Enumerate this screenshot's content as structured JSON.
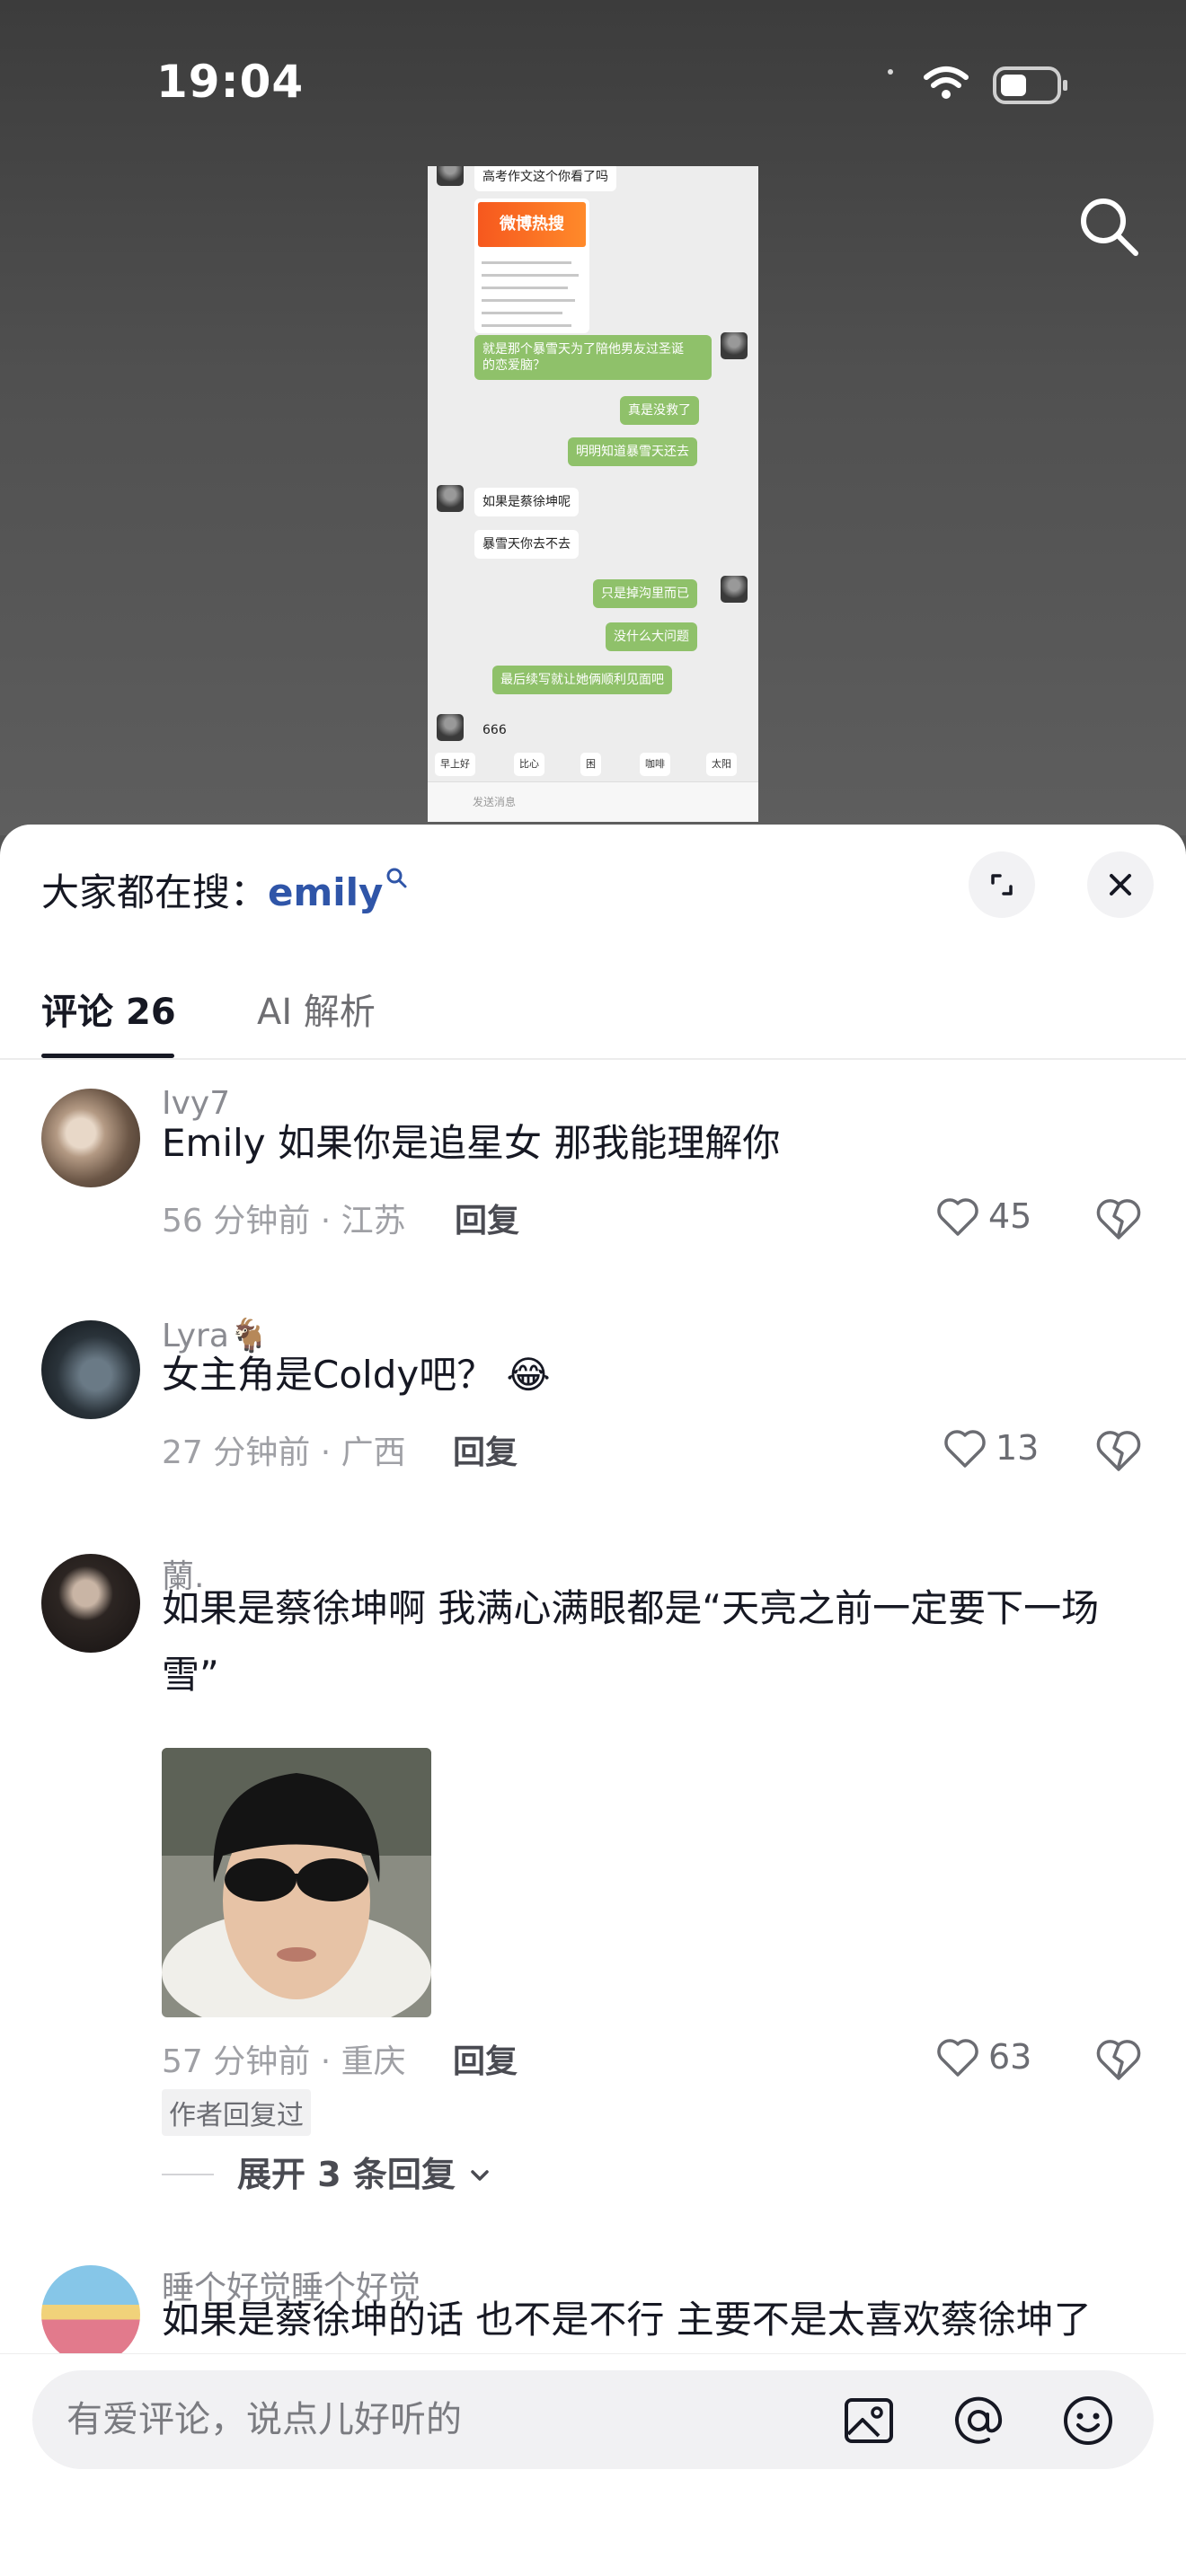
{
  "status_bar": {
    "time": "19:04"
  },
  "chat_preview": {
    "messages": [
      {
        "side": "in",
        "text": "高考作文这个你看了吗"
      },
      {
        "side": "out",
        "text": "就是那个暴雪天为了陪他男友过圣诞"
      },
      {
        "side": "out",
        "text": "的恋爱脑？"
      },
      {
        "side": "out",
        "text": "真是没救了"
      },
      {
        "side": "out",
        "text": "明明知道暴雪天还去"
      },
      {
        "side": "in",
        "text": "如果是蔡徐坤呢"
      },
      {
        "side": "in",
        "text": "暴雪天你去不去"
      },
      {
        "side": "out",
        "text": "只是掉沟里而已"
      },
      {
        "side": "out",
        "text": "没什么大问题"
      },
      {
        "side": "out",
        "text": "最后续写就让她俩顺利见面吧"
      },
      {
        "side": "in",
        "text": "666"
      }
    ],
    "card_title": "微博热搜",
    "quick_replies": [
      "早上好",
      "比心",
      "困",
      "咖啡",
      "太阳"
    ],
    "input_placeholder": "发送消息"
  },
  "sheet": {
    "suggest_label": "大家都在搜：",
    "suggest_keyword": "emily",
    "tabs": [
      {
        "label": "评论",
        "count": "26"
      },
      {
        "label": "AI 解析"
      }
    ]
  },
  "comments": [
    {
      "user": "Ivy7",
      "text": "Emily 如果你是追星女 那我能理解你",
      "time_loc": "56 分钟前 · 江苏",
      "reply_label": "回复",
      "likes": "45"
    },
    {
      "user": "Lyra🐐",
      "text": "女主角是Coldy吧？ 😂",
      "time_loc": "27 分钟前 · 广西",
      "reply_label": "回复",
      "likes": "13"
    },
    {
      "user": "蘭.",
      "text": "如果是蔡徐坤啊 我满心满眼都是“天亮之前一定要下一场雪”",
      "time_loc": "57 分钟前 · 重庆",
      "reply_label": "回复",
      "likes": "63",
      "badge": "作者回复过",
      "expand_label": "展开 3 条回复"
    },
    {
      "user": "睡个好觉睡个好觉",
      "text": "如果是蔡徐坤的话 也不是不行 主要不是太喜欢蔡徐坤了"
    }
  ],
  "input": {
    "placeholder": "有爱评论，说点儿好听的"
  },
  "colors": {
    "keyword": "#2f55a8",
    "bubble_out": "#8fc16a",
    "text_primary": "#161823",
    "text_secondary": "#8a8b91"
  }
}
